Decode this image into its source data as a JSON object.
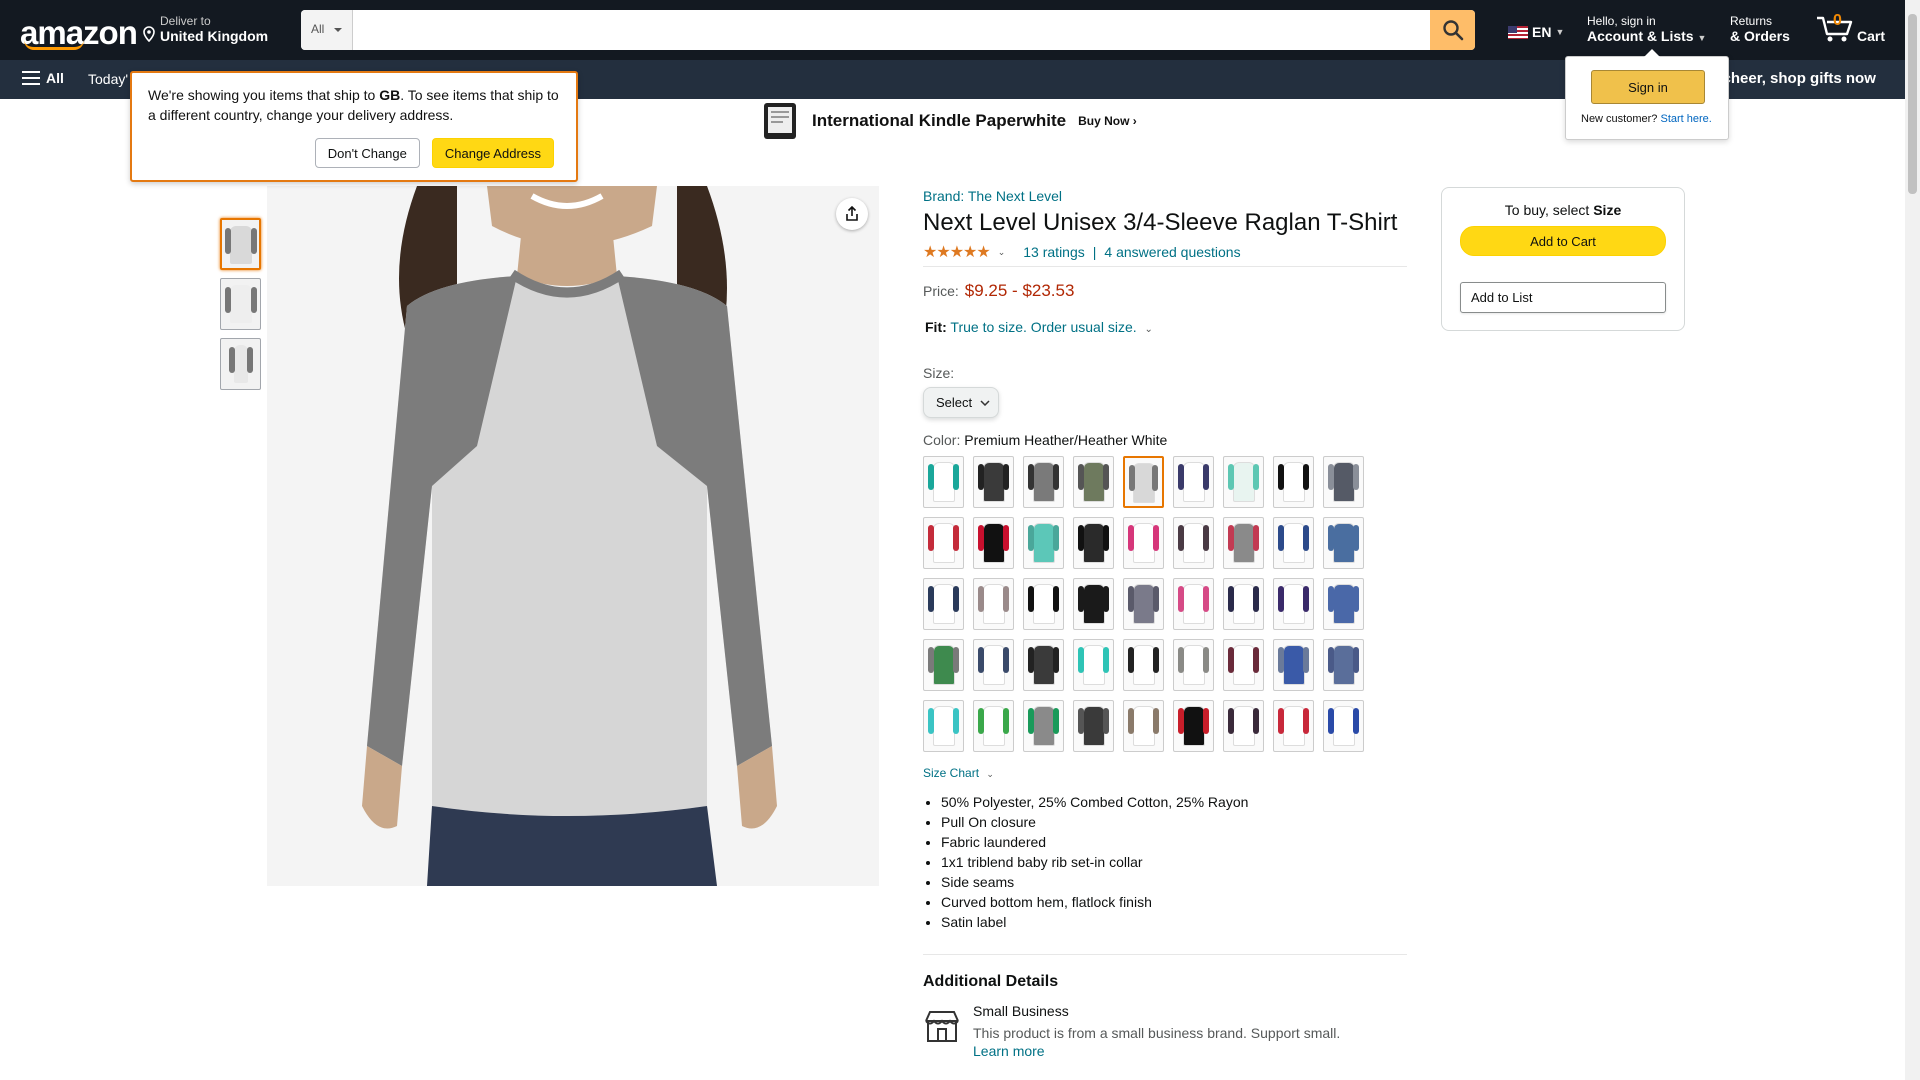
{
  "nav": {
    "logo": "amazon",
    "deliver_line1": "Deliver to",
    "deliver_line2": "United Kingdom",
    "search_category": "All",
    "search_placeholder": "",
    "lang": "EN",
    "account_line1": "Hello, sign in",
    "account_line2": "Account & Lists",
    "returns_line1": "Returns",
    "returns_line2": "& Orders",
    "cart_count": "0",
    "cart_label": "Cart"
  },
  "subnav": {
    "all": "All",
    "todays": "Today'",
    "promo": "e cheer, shop gifts now"
  },
  "banner": {
    "title": "International Kindle Paperwhite",
    "cta": "Buy Now ›"
  },
  "deliver_popover": {
    "text_before": "We're showing you items that ship to ",
    "country": "GB",
    "text_after": ". To see items that ship to a different country, change your delivery address.",
    "dont_change": "Don't Change",
    "change_address": "Change Address"
  },
  "signin_popover": {
    "button": "Sign in",
    "new_customer": "New customer?",
    "start_here": "Start here."
  },
  "product": {
    "brand": "Brand: The Next Level",
    "title": "Next Level Unisex 3/4-Sleeve Raglan T-Shirt",
    "stars": "★★★★★",
    "ratings": "13 ratings",
    "separator": "|",
    "questions": "4 answered questions",
    "price_label": "Price:",
    "price": "$9.25 - $23.53",
    "fit_label": "Fit:",
    "fit_text": "True to size. Order usual size.",
    "size_label": "Size:",
    "size_select": "Select",
    "color_label": "Color:",
    "color_value": "Premium Heather/Heather White",
    "size_chart": "Size Chart",
    "bullets": [
      "50% Polyester, 25% Combed Cotton, 25% Rayon",
      "Pull On closure",
      "Fabric laundered",
      "1x1 triblend baby rib set-in collar",
      "Side seams",
      "Curved bottom hem, flatlock finish",
      "Satin label"
    ],
    "additional_heading": "Additional Details",
    "small_business_title": "Small Business",
    "small_business_desc": "This product is from a small business brand. Support small.",
    "learn_more": "Learn more"
  },
  "buybox": {
    "select_prefix": "To buy, select ",
    "select_size": "Size",
    "add_to_cart": "Add to Cart",
    "add_to_list": "Add to List"
  },
  "swatch_colors": [
    [
      "#ffffff",
      "#1aa79a"
    ],
    [
      "#3a3a3a",
      "#222222"
    ],
    [
      "#7a7a7a",
      "#333333"
    ],
    [
      "#6e7a5e",
      "#555555"
    ],
    [
      "#d8d8d8",
      "#777777"
    ],
    [
      "#ffffff",
      "#3a3a6a"
    ],
    [
      "#e8f4f0",
      "#5dc7b3"
    ],
    [
      "#ffffff",
      "#111111"
    ],
    [
      "#555a66",
      "#8a8f99"
    ],
    [
      "#ffffff",
      "#c42b3a"
    ],
    [
      "#111111",
      "#c8102e"
    ],
    [
      "#5cc7b8",
      "#4aa79a"
    ],
    [
      "#2a2a2a",
      "#111111"
    ],
    [
      "#ffffff",
      "#d6367a"
    ],
    [
      "#ffffff",
      "#4a3a44"
    ],
    [
      "#8a8a8a",
      "#c23a52"
    ],
    [
      "#ffffff",
      "#2c4a8a"
    ],
    [
      "#4a6ea0",
      "#4a6ea0"
    ],
    [
      "#ffffff",
      "#2a3a5a"
    ],
    [
      "#ffffff",
      "#9a8a8a"
    ],
    [
      "#ffffff",
      "#111111"
    ],
    [
      "#1a1a1a",
      "#1a1a1a"
    ],
    [
      "#7a7a8a",
      "#5a5a6a"
    ],
    [
      "#ffffff",
      "#d64a86"
    ],
    [
      "#ffffff",
      "#2a2a4a"
    ],
    [
      "#ffffff",
      "#3a2a6a"
    ],
    [
      "#4a68a8",
      "#4a68a8"
    ],
    [
      "#3e8a4e",
      "#7a7a7a"
    ],
    [
      "#ffffff",
      "#3a4a6a"
    ],
    [
      "#3a3a3a",
      "#222222"
    ],
    [
      "#ffffff",
      "#2ec4b6"
    ],
    [
      "#ffffff",
      "#222222"
    ],
    [
      "#ffffff",
      "#8a8a86"
    ],
    [
      "#ffffff",
      "#6a2a3a"
    ],
    [
      "#3a5aa8",
      "#6a7a9a"
    ],
    [
      "#5a6e9a",
      "#4a5a88"
    ],
    [
      "#ffffff",
      "#3ac4c4"
    ],
    [
      "#ffffff",
      "#3aa84a"
    ],
    [
      "#8a8a8a",
      "#1a9a5a"
    ],
    [
      "#3a3a3a",
      "#555555"
    ],
    [
      "#ffffff",
      "#8a7a6a"
    ],
    [
      "#111111",
      "#c81e2a"
    ],
    [
      "#ffffff",
      "#3a2a3a"
    ],
    [
      "#ffffff",
      "#c8283a"
    ],
    [
      "#ffffff",
      "#2a4aa8"
    ]
  ]
}
